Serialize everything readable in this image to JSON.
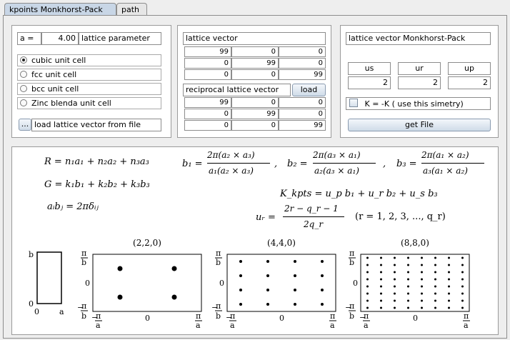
{
  "tabs": [
    {
      "label": "kpoints Monkhorst-Pack"
    },
    {
      "label": "path"
    }
  ],
  "left": {
    "a_label": "a =",
    "a_value": "4.00",
    "a_caption": "lattice parameter",
    "options": [
      "cubic unit cell",
      "fcc unit cell",
      "bcc unit cell",
      "Zinc blenda unit cell"
    ],
    "selected": 0,
    "load_button": "...",
    "load_label": "load lattice vector from file"
  },
  "middle": {
    "lattice_title": "lattice vector",
    "lattice": [
      [
        "99",
        "0",
        "0"
      ],
      [
        "0",
        "99",
        "0"
      ],
      [
        "0",
        "0",
        "99"
      ]
    ],
    "reciprocal_title": "reciprocal lattice vector",
    "load_button": "load",
    "reciprocal": [
      [
        "99",
        "0",
        "0"
      ],
      [
        "0",
        "99",
        "0"
      ],
      [
        "0",
        "0",
        "99"
      ]
    ]
  },
  "right": {
    "title": "lattice vector Monkhorst-Pack",
    "labels": [
      "us",
      "ur",
      "up"
    ],
    "values": [
      "2",
      "2",
      "2"
    ],
    "checkbox_label": "K = -K  ( use this simetry)",
    "checkbox_checked": false,
    "get_file_button": "get File"
  },
  "formulas": {
    "r_eq": "R = n₁a₁ + n₂a₂ + n₃a₃",
    "g_eq": "G = k₁b₁ + k₂b₂ + k₃b₃",
    "ab_eq": "aᵢbⱼ = 2πδᵢⱼ",
    "b1_num": "2π(a₂ × a₃)",
    "b1_den": "a₁(a₂ × a₃)",
    "b2_num": "2π(a₃ × a₁)",
    "b2_den": "a₂(a₃ × a₁)",
    "b3_num": "2π(a₁ × a₂)",
    "b3_den": "a₃(a₁ × a₂)",
    "k_eq": "K_kpts = u_p b₁ + u_r b₂ + u_s b₃",
    "u_num": "2r − q_r − 1",
    "u_den": "2q_r",
    "u_range": "(r = 1, 2, 3, ..., q_r)"
  },
  "plots": {
    "cell": {
      "b": "b",
      "zero_y": "0",
      "zero_x": "0",
      "a": "a"
    },
    "grids": [
      {
        "title": "(2,2,0)",
        "n": 2
      },
      {
        "title": "(4,4,0)",
        "n": 4
      },
      {
        "title": "(8,8,0)",
        "n": 8
      }
    ],
    "pi": "π",
    "b": "b",
    "a": "a",
    "minus": "−",
    "zero": "0"
  }
}
